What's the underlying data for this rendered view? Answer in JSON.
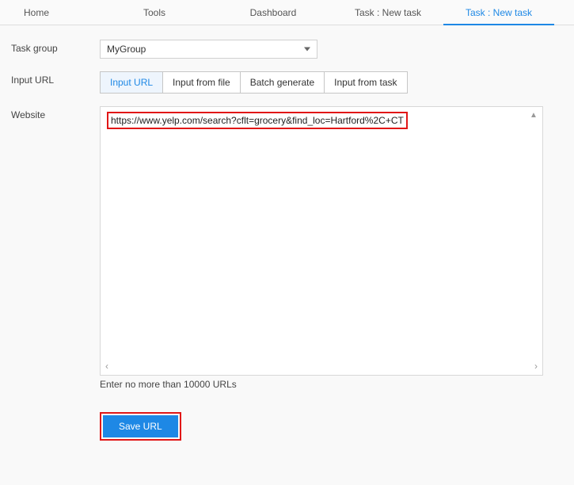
{
  "topTabs": {
    "home": "Home",
    "tools": "Tools",
    "dashboard": "Dashboard",
    "task1": "Task : New task",
    "task2": "Task : New task"
  },
  "labels": {
    "taskGroup": "Task group",
    "inputUrl": "Input URL",
    "website": "Website"
  },
  "taskGroupSelect": {
    "value": "MyGroup"
  },
  "inputMethodTabs": {
    "inputUrl": "Input URL",
    "inputFromFile": "Input from file",
    "batchGenerate": "Batch generate",
    "inputFromTask": "Input from task"
  },
  "websiteTextarea": {
    "value": "https://www.yelp.com/search?cflt=grocery&find_loc=Hartford%2C+CT",
    "hint": "Enter no more than 10000 URLs"
  },
  "saveButton": {
    "label": "Save URL"
  }
}
